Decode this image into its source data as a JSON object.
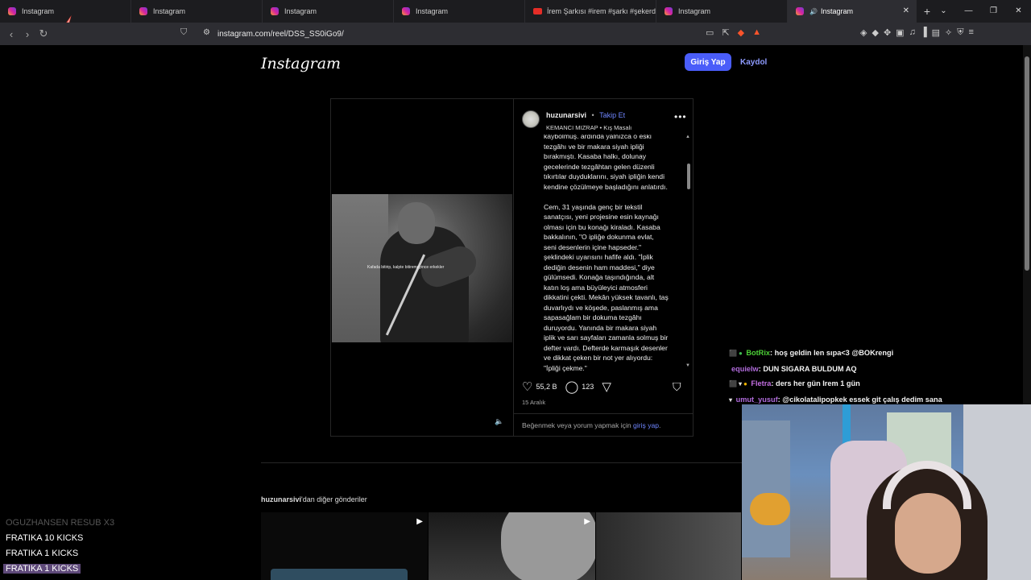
{
  "browser": {
    "tabs": [
      {
        "title": "Instagram",
        "icon": "instagram-icon"
      },
      {
        "title": "Instagram",
        "icon": "instagram-icon"
      },
      {
        "title": "Instagram",
        "icon": "instagram-icon"
      },
      {
        "title": "Instagram",
        "icon": "instagram-icon"
      },
      {
        "title": "İrem Şarkısı #irem #şarkı #şekerday",
        "icon": "youtube-icon"
      },
      {
        "title": "Instagram",
        "icon": "instagram-icon"
      },
      {
        "title": "Instagram",
        "icon": "instagram-icon",
        "active": true
      }
    ],
    "new_tab": "+",
    "url": "instagram.com/reel/DSS_SS0iGo9/"
  },
  "header": {
    "logo": "Instagram",
    "login": "Giriş Yap",
    "signup": "Kaydol"
  },
  "post": {
    "username": "huzunarsivi",
    "dot": "•",
    "follow": "Takip Et",
    "music": "KEMANCI MIZRAP • Kış Masalı",
    "video_caption": "Kafada bitirip, kalpte bitiremeyince erkekler",
    "caption": "kaybolmuş. ardında yalnızca o eski\ntezgâhı ve bir makara siyah ipliği\nbırakmıştı. Kasaba halkı, dolunay\ngecelerinde tezgâhtan gelen düzenli\ntıkırtılar duyduklarını, siyah ipliğin kendi\nkendine çözülmeye başladığını anlatırdı.\n\nCem, 31 yaşında genç bir tekstil\nsanatçısı, yeni projesine esin kaynağı\nolması için bu konağı kiraladı. Kasaba\nbakkalının, \"O ipliğe dokunma evlat,\nseni desenlerin içine hapseder.\"\nşeklindeki uyarısını hafife aldı. \"İplik\ndediğin desenin ham maddesi,\" diye\ngülümsedi. Konağa taşındığında, alt\nkatın loş ama büyüleyici atmosferi\ndikkatini çekti. Mekân yüksek tavanlı, taş\nduvarlıydı ve köşede, paslanmış ama\nsapasağlam bir dokuma tezgâhı\nduruyordu. Yanında bir makara siyah\niplik ve sarı sayfaları zamanla solmuş bir\ndefter vardı. Defterde karmaşık desenler\nve dikkat çeken bir not yer alıyordu:\n\"İpliği çekme.\"",
    "likes": "55,2 B",
    "comments": "123",
    "date": "15 Aralık",
    "login_prompt_pre": "Beğenmek veya yorum yapmak için ",
    "login_prompt_link": "giriş yap",
    "login_prompt_post": "."
  },
  "more_posts": {
    "username": "huzunarsivi",
    "suffix": "'dan diğer gönderiler"
  },
  "chat": [
    {
      "user": "BotRix",
      "color": "#4cd137",
      "badges": [
        "blue",
        "green"
      ],
      "text": ": hoş geldin len sıpa<3 @BOKrengi"
    },
    {
      "user": "equielw",
      "color": "#b06bdb",
      "badges": [],
      "text": ": DUN SIGARA BULDUM AQ"
    },
    {
      "user": "Fletra",
      "color": "#c46fe3",
      "badges": [
        "blue",
        "cat",
        "gold"
      ],
      "text": ": ders her gün Irem 1 gün"
    },
    {
      "user": "umut_yusuf",
      "color": "#b06bdb",
      "badges": [
        "cat"
      ],
      "text": ": @cikolatalipopkek essek git çalış dedim sana"
    }
  ],
  "events": [
    {
      "text": "OGUZHANSEN   RESUB X3",
      "style": "faded"
    },
    {
      "text": "FRATIKA   10 KICKS",
      "style": "normal"
    },
    {
      "text": "FRATIKA   1 KICKS",
      "style": "normal"
    },
    {
      "text": "FRATIKA   1 KICKS",
      "style": "hl"
    }
  ]
}
